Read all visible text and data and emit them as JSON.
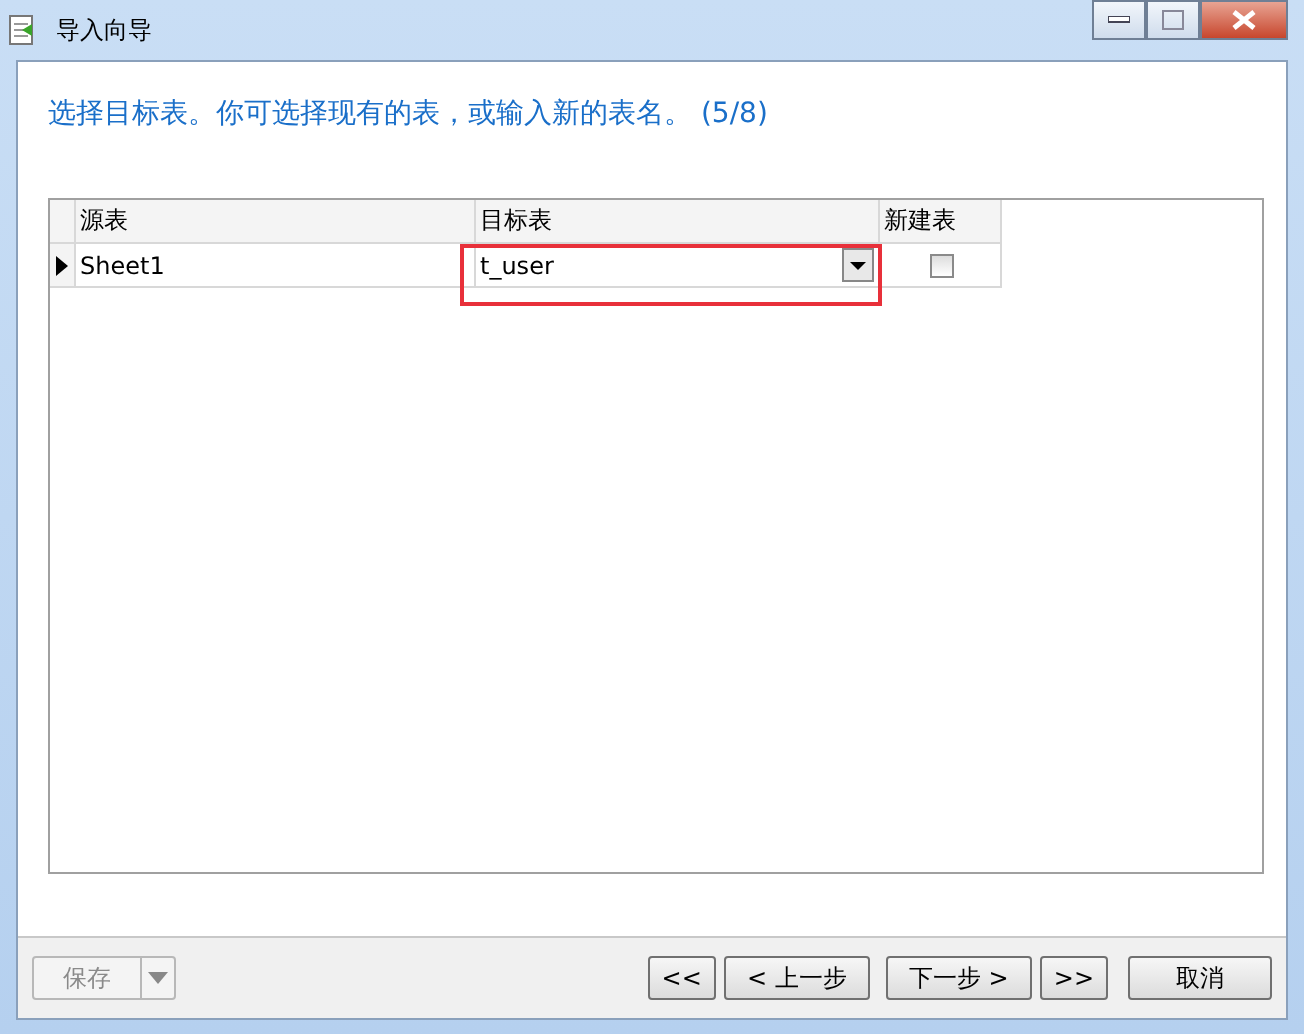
{
  "window": {
    "title": "导入向导"
  },
  "instruction": "选择目标表。你可选择现有的表，或输入新的表名。 (5/8)",
  "table": {
    "columns": [
      "源表",
      "目标表",
      "新建表"
    ],
    "rows": [
      {
        "source": "Sheet1",
        "target": "t_user",
        "new_table": false,
        "current": true
      }
    ]
  },
  "footer": {
    "save": {
      "label": "保存",
      "disabled": true
    },
    "buttons": [
      {
        "label": "<<",
        "kind": "first"
      },
      {
        "label": "< 上一步",
        "kind": "back"
      },
      {
        "label": "下一步 >",
        "kind": "next"
      },
      {
        "label": ">>",
        "kind": "last"
      },
      {
        "label": "取消",
        "kind": "cancel"
      }
    ]
  }
}
